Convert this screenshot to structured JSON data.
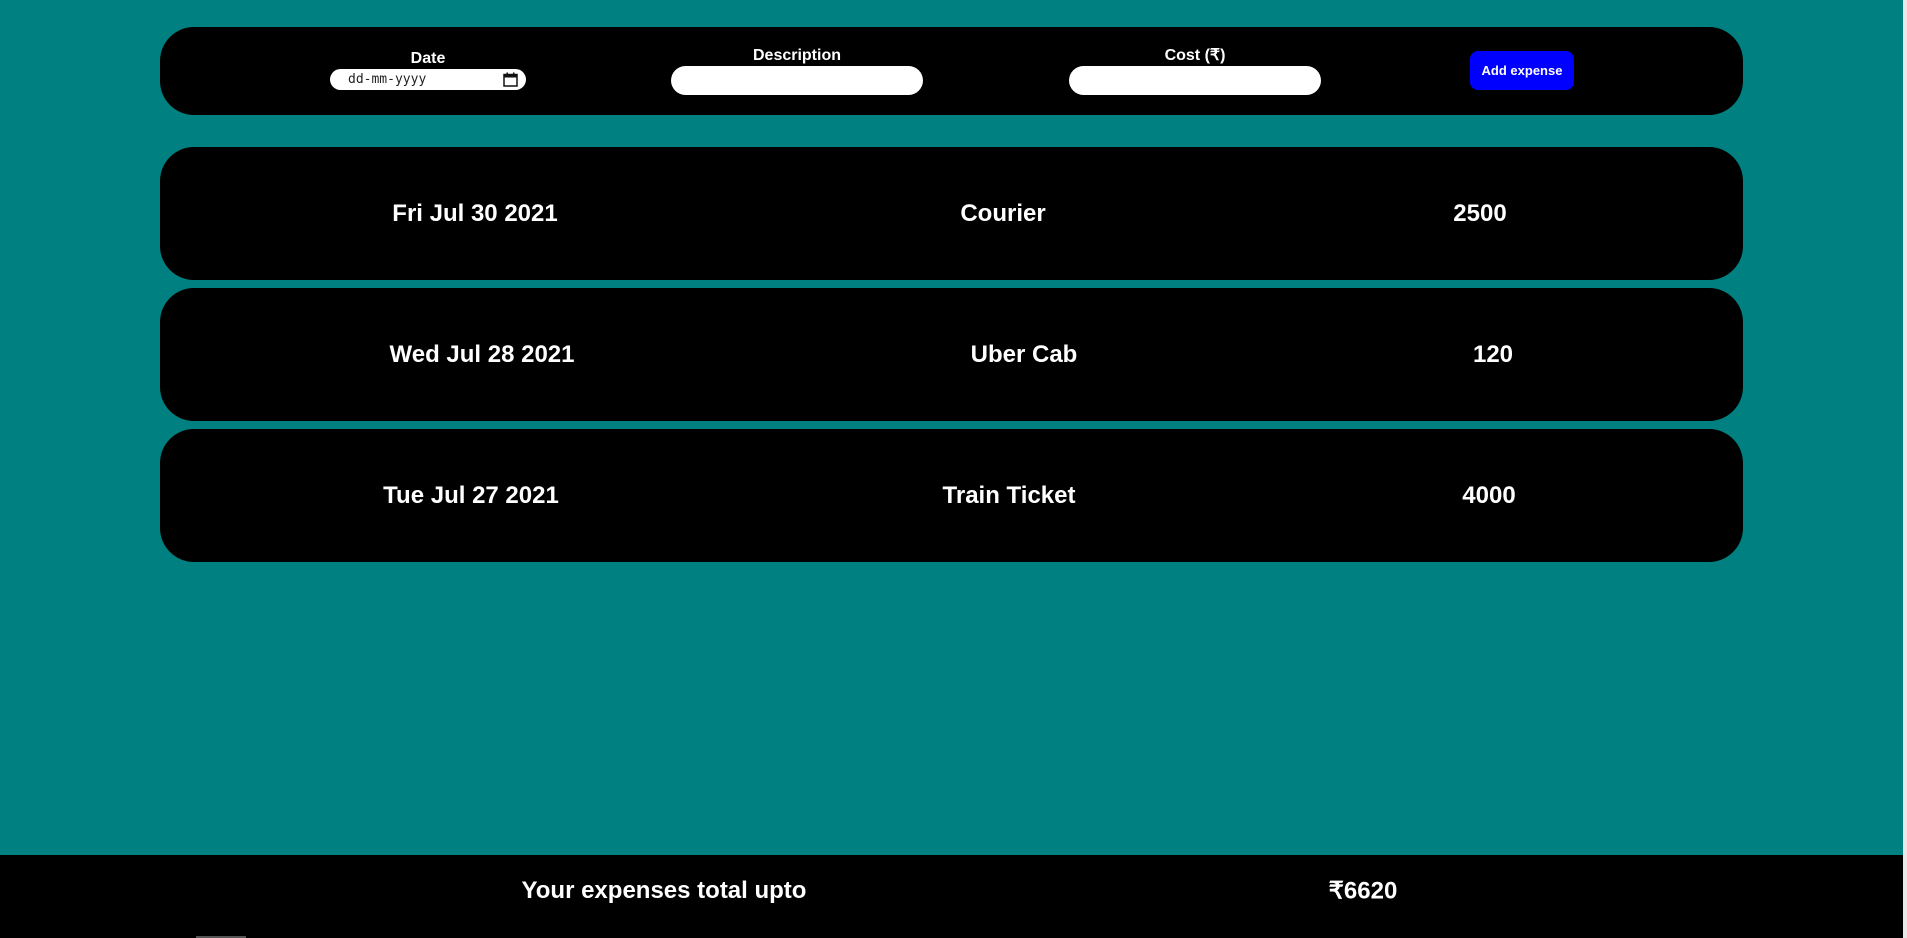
{
  "form": {
    "date_label": "Date",
    "date_placeholder": "dd-mm-yyyy",
    "description_label": "Description",
    "description_value": "",
    "cost_label": "Cost (₹)",
    "cost_value": "",
    "add_button_label": "Add expense",
    "calendar_icon": "calendar-icon"
  },
  "expenses": [
    {
      "date": "Fri Jul 30 2021",
      "description": "Courier",
      "cost": "2500"
    },
    {
      "date": "Wed Jul 28 2021",
      "description": "Uber Cab",
      "cost": "120"
    },
    {
      "date": "Tue Jul 27 2021",
      "description": "Train Ticket",
      "cost": "4000"
    }
  ],
  "footer": {
    "total_label": "Your expenses total upto",
    "total_value": "₹6620"
  },
  "colors": {
    "background": "#008080",
    "panel": "#000000",
    "accent_button": "#0000ff",
    "text": "#ffffff"
  }
}
